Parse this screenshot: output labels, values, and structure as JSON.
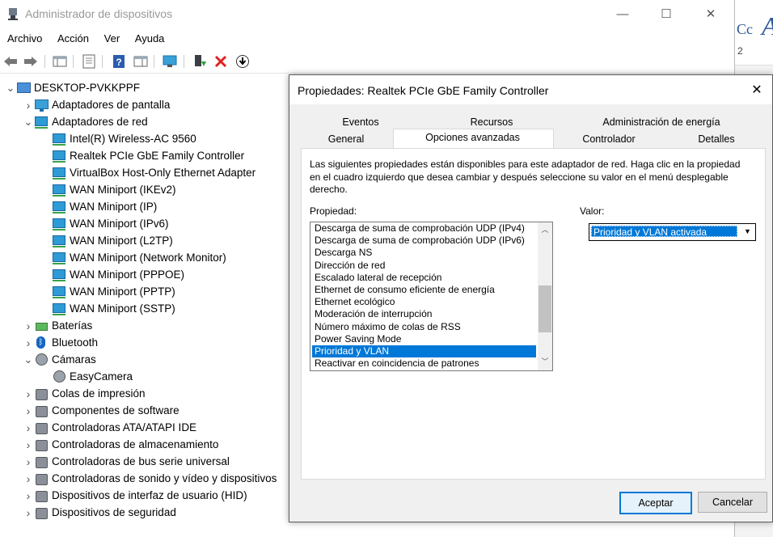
{
  "window": {
    "title": "Administrador de dispositivos",
    "minimize": "—",
    "maximize": "☐",
    "close": "✕"
  },
  "menu": [
    "Archivo",
    "Acción",
    "Ver",
    "Ayuda"
  ],
  "background_app": {
    "style_text": "Cc",
    "style_big": "A",
    "number": "2"
  },
  "tree": {
    "root": "DESKTOP-PVKKPPF",
    "nodes": [
      {
        "label": "Adaptadores de pantalla",
        "level": 1,
        "expanded": false,
        "icon": "monitor-icon"
      },
      {
        "label": "Adaptadores de red",
        "level": 1,
        "expanded": true,
        "icon": "network-adapter-icon"
      },
      {
        "label": "Intel(R) Wireless-AC 9560",
        "level": 2,
        "icon": "network-adapter-icon"
      },
      {
        "label": "Realtek PCIe GbE Family Controller",
        "level": 2,
        "icon": "network-adapter-icon"
      },
      {
        "label": "VirtualBox Host-Only Ethernet Adapter",
        "level": 2,
        "icon": "network-adapter-icon"
      },
      {
        "label": "WAN Miniport (IKEv2)",
        "level": 2,
        "icon": "network-adapter-icon"
      },
      {
        "label": "WAN Miniport (IP)",
        "level": 2,
        "icon": "network-adapter-icon"
      },
      {
        "label": "WAN Miniport (IPv6)",
        "level": 2,
        "icon": "network-adapter-icon"
      },
      {
        "label": "WAN Miniport (L2TP)",
        "level": 2,
        "icon": "network-adapter-icon"
      },
      {
        "label": "WAN Miniport (Network Monitor)",
        "level": 2,
        "icon": "network-adapter-icon"
      },
      {
        "label": "WAN Miniport (PPPOE)",
        "level": 2,
        "icon": "network-adapter-icon"
      },
      {
        "label": "WAN Miniport (PPTP)",
        "level": 2,
        "icon": "network-adapter-icon"
      },
      {
        "label": "WAN Miniport (SSTP)",
        "level": 2,
        "icon": "network-adapter-icon"
      },
      {
        "label": "Baterías",
        "level": 1,
        "expanded": false,
        "icon": "battery-icon"
      },
      {
        "label": "Bluetooth",
        "level": 1,
        "expanded": false,
        "icon": "bluetooth-icon"
      },
      {
        "label": "Cámaras",
        "level": 1,
        "expanded": true,
        "icon": "camera-icon"
      },
      {
        "label": "EasyCamera",
        "level": 2,
        "icon": "camera-icon"
      },
      {
        "label": "Colas de impresión",
        "level": 1,
        "expanded": false,
        "icon": "printer-icon"
      },
      {
        "label": "Componentes de software",
        "level": 1,
        "expanded": false,
        "icon": "software-component-icon"
      },
      {
        "label": "Controladoras ATA/ATAPI IDE",
        "level": 1,
        "expanded": false,
        "icon": "ide-controller-icon"
      },
      {
        "label": "Controladoras de almacenamiento",
        "level": 1,
        "expanded": false,
        "icon": "storage-controller-icon"
      },
      {
        "label": "Controladoras de bus serie universal",
        "level": 1,
        "expanded": false,
        "icon": "usb-icon"
      },
      {
        "label": "Controladoras de sonido y vídeo y dispositivos",
        "level": 1,
        "expanded": false,
        "icon": "speaker-icon"
      },
      {
        "label": "Dispositivos de interfaz de usuario (HID)",
        "level": 1,
        "expanded": false,
        "icon": "hid-icon"
      },
      {
        "label": "Dispositivos de seguridad",
        "level": 1,
        "expanded": false,
        "icon": "security-device-icon"
      }
    ]
  },
  "dialog": {
    "title": "Propiedades: Realtek PCIe GbE Family Controller",
    "tabs_row1": [
      "Eventos",
      "Recursos",
      "Administración de energía"
    ],
    "tabs_row2": [
      "General",
      "Opciones avanzadas",
      "Controlador",
      "Detalles"
    ],
    "selected_tab": "Opciones avanzadas",
    "description": "Las siguientes propiedades están disponibles para este adaptador de red. Haga clic en la propiedad en el cuadro izquierdo que desea cambiar y después seleccione su valor en el menú desplegable derecho.",
    "property_label": "Propiedad:",
    "value_label": "Valor:",
    "properties": [
      "Descarga de suma de comprobación UDP (IPv4)",
      "Descarga de suma de comprobación UDP (IPv6)",
      "Descarga NS",
      "Dirección de red",
      "Escalado lateral de recepción",
      "Ethernet de consumo eficiente de energía",
      "Ethernet ecológico",
      "Moderación de interrupción",
      "Número máximo de colas de RSS",
      "Power Saving Mode",
      "Prioridad y VLAN",
      "Reactivar en coincidencia de patrones"
    ],
    "selected_property": "Prioridad y VLAN",
    "value": "Prioridad y VLAN activada",
    "ok_label": "Aceptar",
    "cancel_label": "Cancelar"
  },
  "colors": {
    "selection": "#0078d7",
    "dialog_bg": "#f0f0f0"
  }
}
